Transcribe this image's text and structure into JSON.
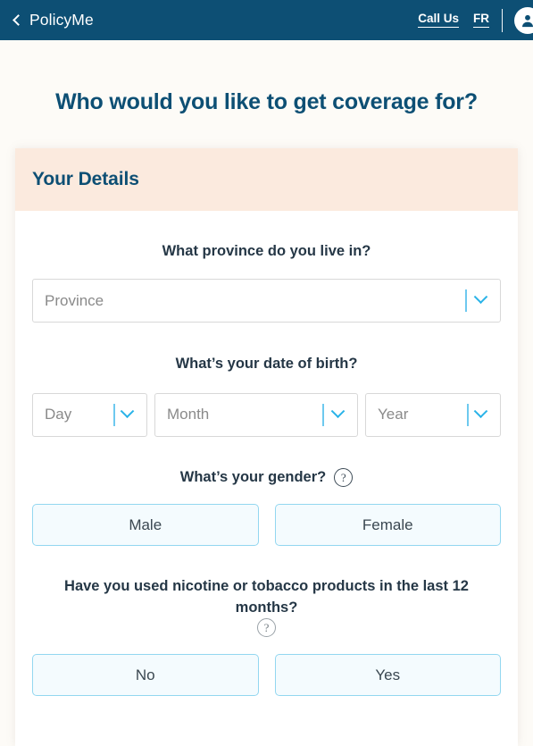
{
  "header": {
    "brand": "PolicyMe",
    "back_icon": "back-chevron-icon",
    "call_us": "Call Us",
    "language": "FR",
    "account_icon": "user-avatar-icon"
  },
  "page": {
    "title": "Who would you like to get coverage for?"
  },
  "card": {
    "banner_title": "Your Details",
    "province": {
      "question": "What province do you live in?",
      "placeholder": "Province",
      "value": "Province"
    },
    "dob": {
      "question": "What’s your date of birth?",
      "day": "Day",
      "month": "Month",
      "year": "Year"
    },
    "gender": {
      "question": "What’s your gender?",
      "help_icon": "question-mark-icon",
      "options": [
        "Male",
        "Female"
      ]
    },
    "nicotine": {
      "question": "Have you used nicotine or tobacco products in the last 12 months?",
      "help_icon": "question-mark-icon",
      "options": [
        "No",
        "Yes"
      ]
    }
  },
  "colors": {
    "header_bg": "#0d4f74",
    "page_bg": "#fdfbf7",
    "banner_bg": "#fbeade",
    "brand_navy": "#0d4f74",
    "accent_blue": "#2ab3e8",
    "choice_border": "#93d7f0",
    "choice_bg": "#f4fbfe",
    "text_dark": "#253746",
    "placeholder_gray": "#8a8a8a"
  }
}
